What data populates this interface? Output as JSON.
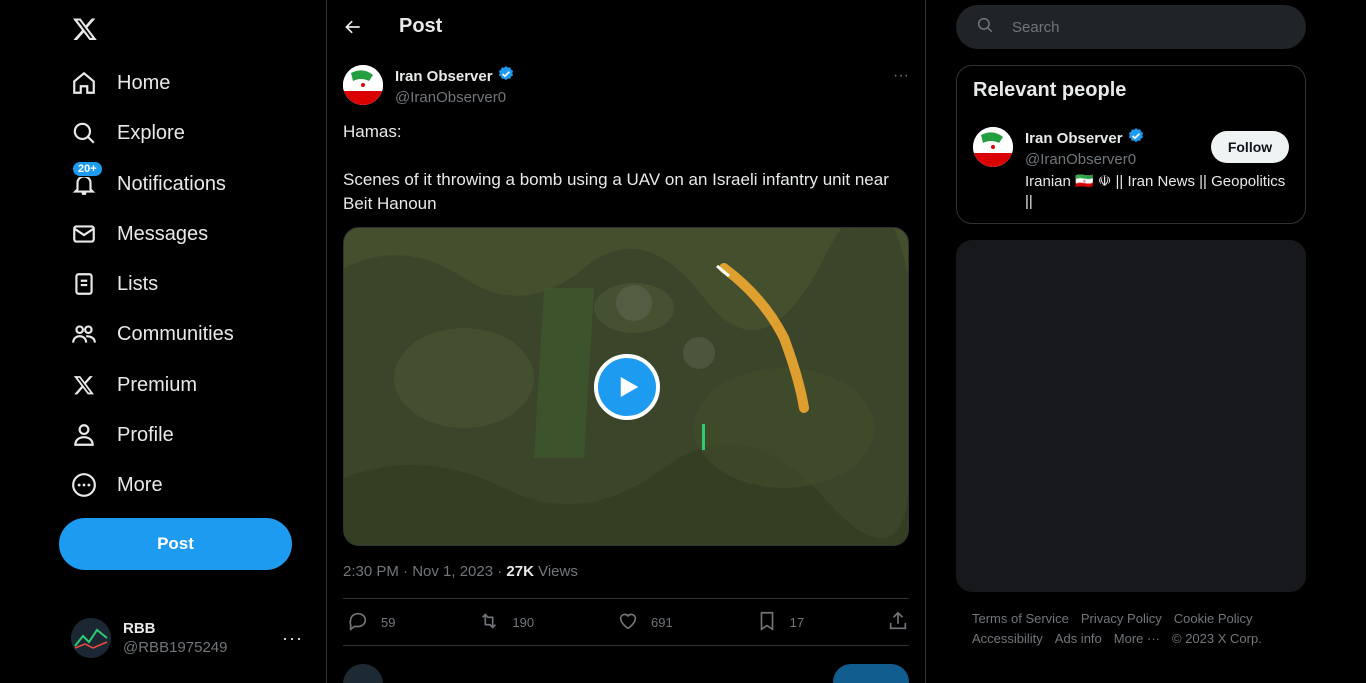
{
  "nav": {
    "items": [
      {
        "label": "Home",
        "icon": "home-icon"
      },
      {
        "label": "Explore",
        "icon": "search-icon"
      },
      {
        "label": "Notifications",
        "icon": "bell-icon",
        "badge": "20+"
      },
      {
        "label": "Messages",
        "icon": "envelope-icon"
      },
      {
        "label": "Lists",
        "icon": "list-icon"
      },
      {
        "label": "Communities",
        "icon": "people-icon"
      },
      {
        "label": "Premium",
        "icon": "x-logo-icon"
      },
      {
        "label": "Profile",
        "icon": "person-icon"
      },
      {
        "label": "More",
        "icon": "more-circle-icon"
      }
    ],
    "post_button": "Post",
    "account": {
      "name": "RBB",
      "handle": "@RBB1975249",
      "more": "···"
    }
  },
  "header": {
    "title": "Post"
  },
  "tweet": {
    "author_name": "Iran Observer",
    "author_handle": "@IranObserver0",
    "more": "···",
    "text_line1": "Hamas:",
    "text_line2": "Scenes of it throwing a bomb using a UAV on an Israeli infantry unit near Beit Hanoun",
    "time": "2:30 PM · Nov 1, 2023 · ",
    "views_count": "27K",
    "views_label": " Views",
    "stats": {
      "replies": "59",
      "reposts": "190",
      "likes": "691",
      "bookmarks": "17"
    }
  },
  "search": {
    "placeholder": "Search"
  },
  "relevant": {
    "title": "Relevant people",
    "name": "Iran Observer",
    "handle": "@IranObserver0",
    "follow": "Follow",
    "bio": "Iranian 🇮🇷 ☫ || Iran News || Geopolitics ||"
  },
  "footer": {
    "links": [
      "Terms of Service",
      "Privacy Policy",
      "Cookie Policy",
      "Accessibility",
      "Ads info",
      "More ···",
      "© 2023 X Corp."
    ]
  },
  "colors": {
    "accent": "#1d9bf0",
    "background": "#000000",
    "text": "#e7e9ea",
    "muted": "#71767b",
    "verified": "#1d9bf0"
  }
}
